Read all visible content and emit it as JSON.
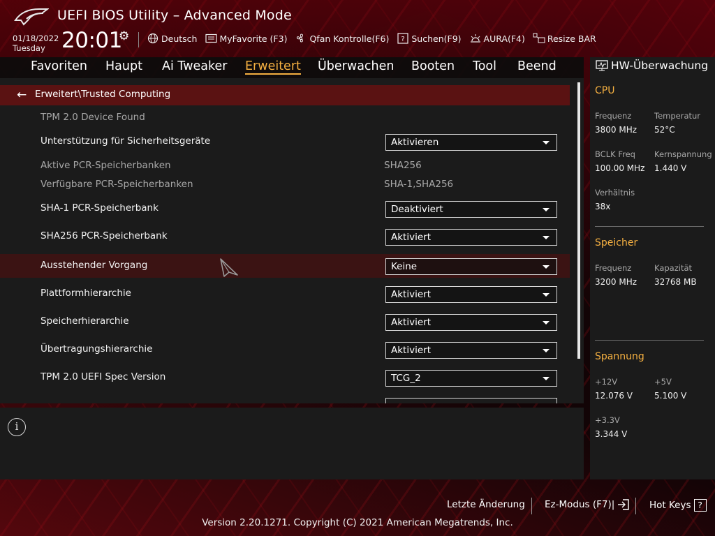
{
  "header": {
    "title": "UEFI BIOS Utility – Advanced Mode",
    "date": "01/18/2022",
    "weekday": "Tuesday",
    "time": "20:01",
    "toolbar": [
      {
        "icon": "globe-icon",
        "label": "Deutsch"
      },
      {
        "icon": "myfavorite-icon",
        "label": "MyFavorite (F3)"
      },
      {
        "icon": "fan-icon",
        "label": "Qfan Kontrolle(F6)"
      },
      {
        "icon": "search-help-icon",
        "label": "Suchen(F9)"
      },
      {
        "icon": "aura-icon",
        "label": "AURA(F4)"
      },
      {
        "icon": "resize-bar-icon",
        "label": "Resize BAR"
      }
    ]
  },
  "nav": {
    "tabs": [
      "Favoriten",
      "Haupt",
      "Ai Tweaker",
      "Erweitert",
      "Überwachen",
      "Booten",
      "Tool",
      "Beend"
    ],
    "active": "Erweitert"
  },
  "breadcrumb": "Erweitert\\Trusted Computing",
  "settings": [
    {
      "label": "TPM 2.0 Device Found",
      "type": "info"
    },
    {
      "label": "Unterstützung für Sicherheitsgeräte",
      "type": "dropdown",
      "value": "Aktivieren"
    },
    {
      "label": "Aktive PCR-Speicherbanken",
      "type": "readonly",
      "value": "SHA256"
    },
    {
      "label": "Verfügbare PCR-Speicherbanken",
      "type": "readonly",
      "value": "SHA-1,SHA256"
    },
    {
      "label": "SHA-1 PCR-Speicherbank",
      "type": "dropdown",
      "value": "Deaktiviert"
    },
    {
      "label": "SHA256 PCR-Speicherbank",
      "type": "dropdown",
      "value": "Aktiviert"
    },
    {
      "label": "Ausstehender Vorgang",
      "type": "dropdown",
      "value": "Keine",
      "selected": true
    },
    {
      "label": "Plattformhierarchie",
      "type": "dropdown",
      "value": "Aktiviert"
    },
    {
      "label": "Speicherhierarchie",
      "type": "dropdown",
      "value": "Aktiviert"
    },
    {
      "label": "Übertragungshierarchie",
      "type": "dropdown",
      "value": "Aktiviert"
    },
    {
      "label": "TPM 2.0 UEFI Spec Version",
      "type": "dropdown",
      "value": "TCG_2"
    }
  ],
  "hw_monitor": {
    "title": "HW-Überwachung",
    "cpu": {
      "heading": "CPU",
      "frequenz_label": "Frequenz",
      "frequenz": "3800 MHz",
      "temperatur_label": "Temperatur",
      "temperatur": "52°C",
      "bclk_label": "BCLK Freq",
      "bclk": "100.00 MHz",
      "kernspannung_label": "Kernspannung",
      "kernspannung": "1.440 V",
      "verhaeltnis_label": "Verhältnis",
      "verhaeltnis": "38x"
    },
    "speicher": {
      "heading": "Speicher",
      "frequenz_label": "Frequenz",
      "frequenz": "3200 MHz",
      "kapazitaet_label": "Kapazität",
      "kapazitaet": "32768 MB"
    },
    "spannung": {
      "heading": "Spannung",
      "v12_label": "+12V",
      "v12": "12.076 V",
      "v5_label": "+5V",
      "v5": "5.100 V",
      "v33_label": "+3.3V",
      "v33": "3.344 V"
    }
  },
  "footer": {
    "last_change": "Letzte Änderung",
    "ez_mode": "Ez-Modus (F7)|",
    "hot_keys": "Hot Keys",
    "hot_keys_symbol": "?",
    "version": "Version 2.20.1271. Copyright (C) 2021 American Megatrends, Inc."
  },
  "colors": {
    "accent": "#f5b041",
    "selected_row": "#3b1313",
    "breadcrumb_bg": "#5a1212",
    "panel_bg": "#1b1b1b"
  }
}
